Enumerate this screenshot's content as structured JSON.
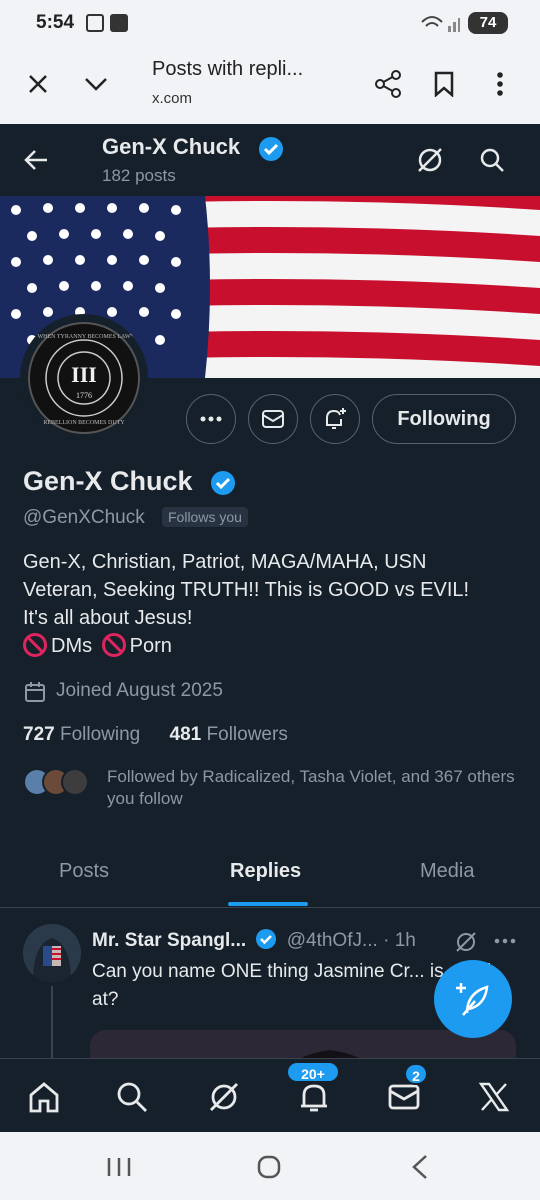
{
  "status_bar": {
    "time": "5:54",
    "battery": "74"
  },
  "browser": {
    "page_title": "Posts with repli...",
    "url": "x.com"
  },
  "header": {
    "name": "Gen-X Chuck",
    "post_count": "182 posts"
  },
  "avatar_text": {
    "top": "WHEN TYRANNY BECOMES LAW",
    "bottom": "REBELLION BECOMES DUTY",
    "center": "III",
    "year": "1776"
  },
  "profile": {
    "follow_button": "Following",
    "display_name": "Gen-X Chuck",
    "handle": "@GenXChuck",
    "follows_you": "Follows you",
    "bio_line1": "Gen-X, Christian, Patriot, MAGA/MAHA, USN",
    "bio_line2": "Veteran, Seeking TRUTH!! This is GOOD vs EVIL!",
    "bio_line3": "It's all about Jesus!",
    "bio_dms": "DMs",
    "bio_porn": "Porn",
    "joined": "Joined August 2025",
    "following_count": "727",
    "following_label": "Following",
    "followers_count": "481",
    "followers_label": "Followers",
    "followed_by": "Followed by Radicalized, Tasha Violet, and 367 others you follow"
  },
  "tabs": [
    "Posts",
    "Replies",
    "Media"
  ],
  "active_tab": "Replies",
  "reply": {
    "author": "Mr. Star Spangl...",
    "handle": "@4thOfJ...",
    "time": "· 1h",
    "text": "Can you name ONE thing Jasmine Cr... is good at?"
  },
  "bottom_nav": {
    "notifications_badge": "20+",
    "messages_badge": "2"
  },
  "colors": {
    "background": "#15202b",
    "accent": "#1d9bf0",
    "muted": "#8b98a5"
  }
}
